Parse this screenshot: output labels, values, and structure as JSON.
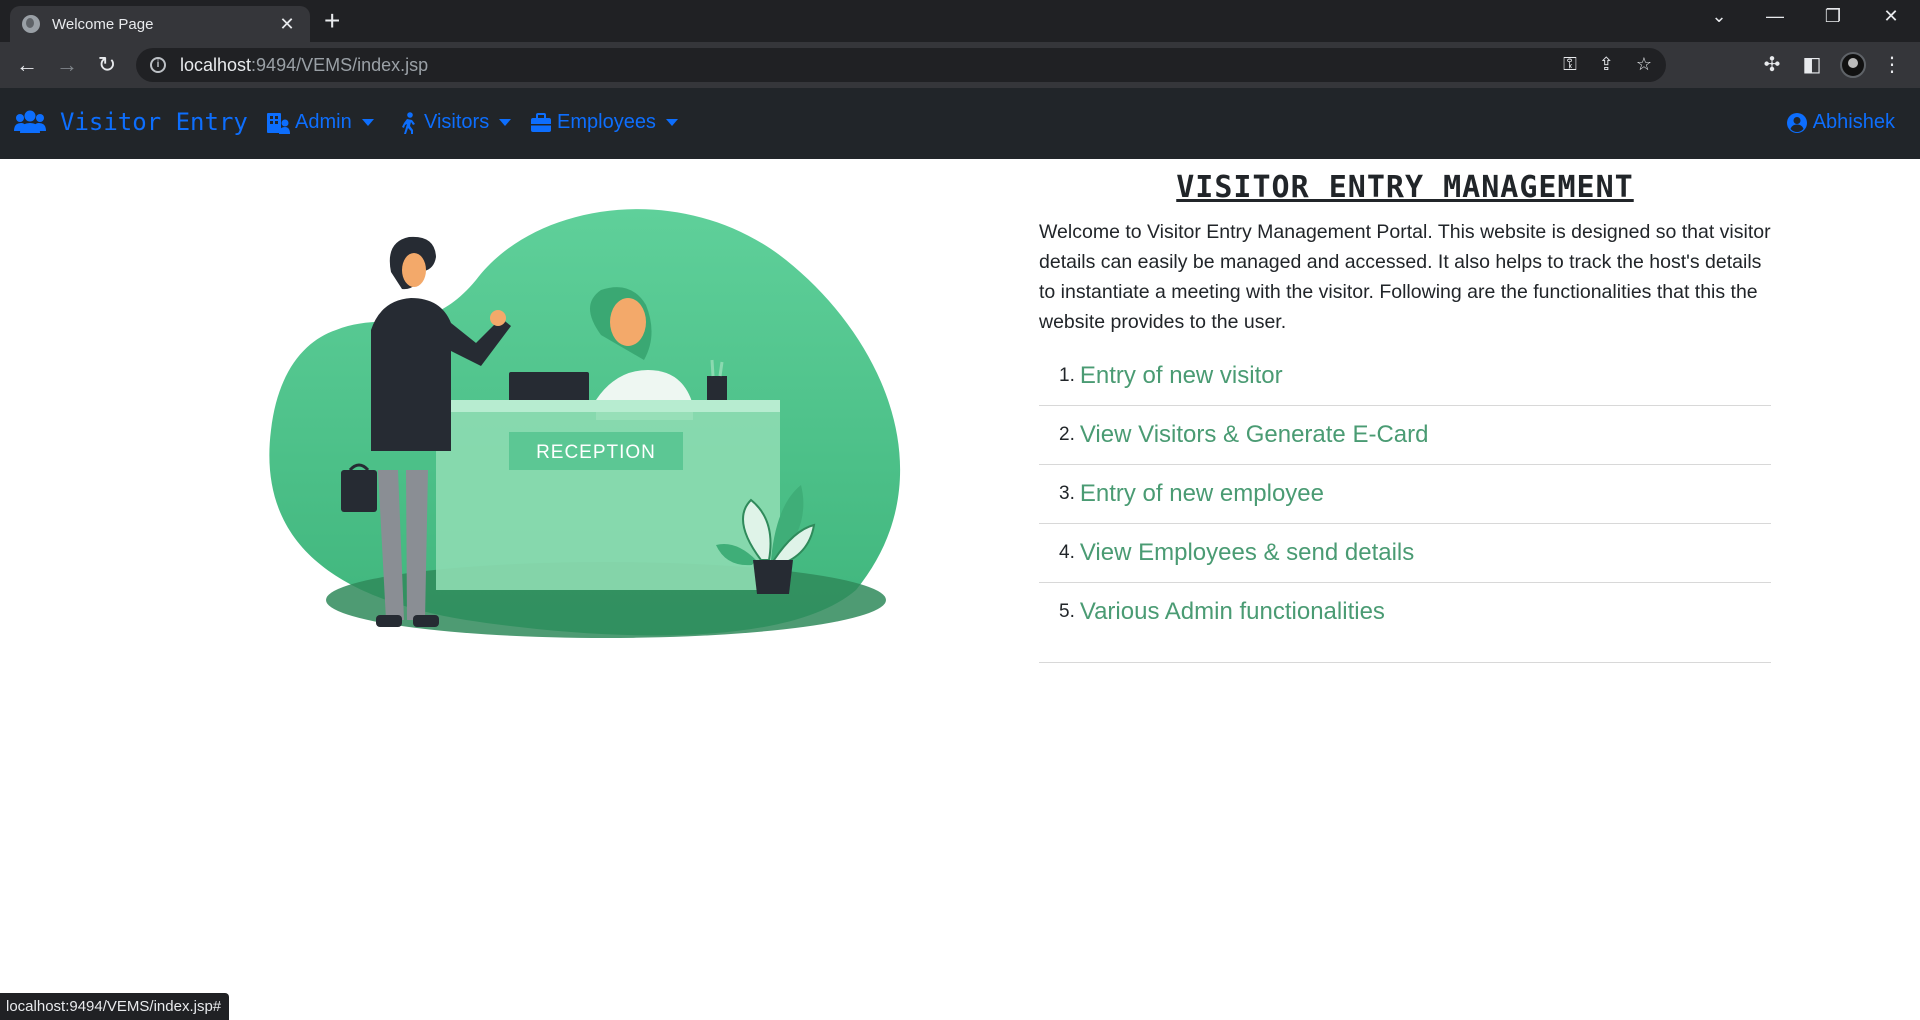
{
  "browser": {
    "tab_title": "Welcome Page",
    "url_host": "localhost",
    "url_rest": ":9494/VEMS/index.jsp",
    "status_url": "localhost:9494/VEMS/index.jsp#"
  },
  "navbar": {
    "brand": "Visitor Entry",
    "items": [
      {
        "label": "Admin",
        "icon": "building-user-icon"
      },
      {
        "label": "Visitors",
        "icon": "person-walking-icon"
      },
      {
        "label": "Employees",
        "icon": "briefcase-icon"
      }
    ],
    "user": "Abhishek"
  },
  "hero": {
    "reception_label": "RECEPTION"
  },
  "main": {
    "title": "VISITOR ENTRY MANAGEMENT",
    "intro": "Welcome to Visitor Entry Management Portal. This website is designed so that visitor details can easily be managed and accessed. It also helps to track the host's details to instantiate a meeting with the visitor. Following are the functionalities that this the website provides to the user.",
    "functions": [
      {
        "num": "1.",
        "label": "Entry of new visitor"
      },
      {
        "num": "2.",
        "label": "View Visitors & Generate E-Card"
      },
      {
        "num": "3.",
        "label": "Entry of new employee"
      },
      {
        "num": "4.",
        "label": "View Employees & send details"
      },
      {
        "num": "5.",
        "label": "Various Admin functionalities"
      }
    ]
  },
  "colors": {
    "navbar_bg": "#212529",
    "link_blue": "#0d6efd",
    "accent_green": "#4a9b73"
  }
}
